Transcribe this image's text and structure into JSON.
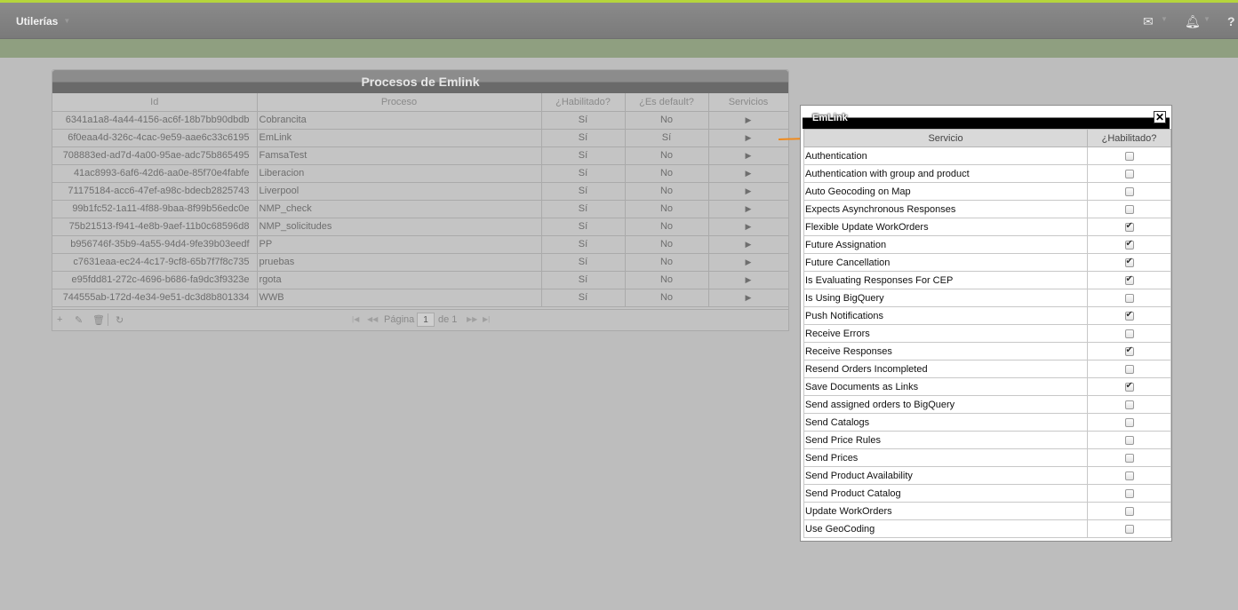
{
  "topbar": {
    "brand": "Utilerías",
    "icons": [
      "mail-icon",
      "bell-icon",
      "help-icon"
    ]
  },
  "grid": {
    "title": "Procesos de Emlink",
    "columns": [
      "Id",
      "Proceso",
      "¿Habilitado?",
      "¿Es default?",
      "Servicios"
    ],
    "rows": [
      {
        "id": "6341a1a8-4a44-4156-ac6f-18b7bb90dbdb",
        "proceso": "Cobrancita",
        "habilitado": "Sí",
        "default": "No"
      },
      {
        "id": "6f0eaa4d-326c-4cac-9e59-aae6c33c6195",
        "proceso": "EmLink",
        "habilitado": "Sí",
        "default": "Sí"
      },
      {
        "id": "708883ed-ad7d-4a00-95ae-adc75b865495",
        "proceso": "FamsaTest",
        "habilitado": "Sí",
        "default": "No"
      },
      {
        "id": "41ac8993-6af6-42d6-aa0e-85f70e4fabfe",
        "proceso": "Liberacion",
        "habilitado": "Sí",
        "default": "No"
      },
      {
        "id": "71175184-acc6-47ef-a98c-bdecb2825743",
        "proceso": "Liverpool",
        "habilitado": "Sí",
        "default": "No"
      },
      {
        "id": "99b1fc52-1a11-4f88-9baa-8f99b56edc0e",
        "proceso": "NMP_check",
        "habilitado": "Sí",
        "default": "No"
      },
      {
        "id": "75b21513-f941-4e8b-9aef-11b0c68596d8",
        "proceso": "NMP_solicitudes",
        "habilitado": "Sí",
        "default": "No"
      },
      {
        "id": "b956746f-35b9-4a55-94d4-9fe39b03eedf",
        "proceso": "PP",
        "habilitado": "Sí",
        "default": "No"
      },
      {
        "id": "c7631eaa-ec24-4c17-9cf8-65b7f7f8c735",
        "proceso": "pruebas",
        "habilitado": "Sí",
        "default": "No"
      },
      {
        "id": "e95fdd81-272c-4696-b686-fa9dc3f9323e",
        "proceso": "rgota",
        "habilitado": "Sí",
        "default": "No"
      },
      {
        "id": "744555ab-172d-4e34-9e51-dc3d8b801334",
        "proceso": "WWB",
        "habilitado": "Sí",
        "default": "No"
      }
    ],
    "pager": {
      "page_label": "Página",
      "page_value": "1",
      "of_label": "de 1"
    }
  },
  "dialog": {
    "title": "EmLink",
    "columns": [
      "Servicio",
      "¿Habilitado?"
    ],
    "services": [
      {
        "name": "Authentication",
        "enabled": false
      },
      {
        "name": "Authentication with group and product",
        "enabled": false
      },
      {
        "name": "Auto Geocoding on Map",
        "enabled": false
      },
      {
        "name": "Expects Asynchronous Responses",
        "enabled": false
      },
      {
        "name": "Flexible Update WorkOrders",
        "enabled": true
      },
      {
        "name": "Future Assignation",
        "enabled": true
      },
      {
        "name": "Future Cancellation",
        "enabled": true
      },
      {
        "name": "Is Evaluating Responses For CEP",
        "enabled": true
      },
      {
        "name": "Is Using BigQuery",
        "enabled": false
      },
      {
        "name": "Push Notifications",
        "enabled": true
      },
      {
        "name": "Receive Errors",
        "enabled": false
      },
      {
        "name": "Receive Responses",
        "enabled": true
      },
      {
        "name": "Resend Orders Incompleted",
        "enabled": false
      },
      {
        "name": "Save Documents as Links",
        "enabled": true
      },
      {
        "name": "Send assigned orders to BigQuery",
        "enabled": false
      },
      {
        "name": "Send Catalogs",
        "enabled": false
      },
      {
        "name": "Send Price Rules",
        "enabled": false
      },
      {
        "name": "Send Prices",
        "enabled": false
      },
      {
        "name": "Send Product Availability",
        "enabled": false
      },
      {
        "name": "Send Product Catalog",
        "enabled": false
      },
      {
        "name": "Update WorkOrders",
        "enabled": false
      },
      {
        "name": "Use GeoCoding",
        "enabled": false
      }
    ]
  },
  "colors": {
    "accent_stripe": "#b5d53c",
    "subbar": "#8f9f80",
    "arrow": "#f08a1c"
  }
}
